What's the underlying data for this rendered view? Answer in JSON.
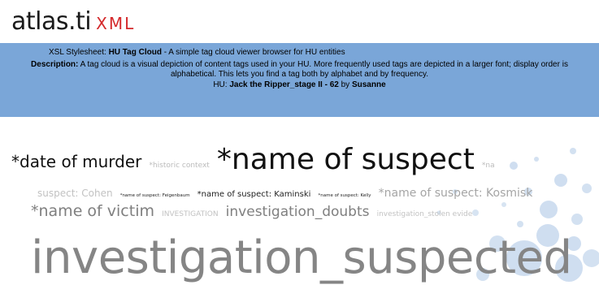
{
  "logo": {
    "main": "atlas.ti",
    "xml": "XML"
  },
  "header": {
    "xsl_prefix": "XSL Stylesheet: ",
    "xsl_name": "HU Tag Cloud",
    "xsl_suffix": " - A simple tag cloud viewer browser for HU entities",
    "desc_label": "Description:",
    "desc_text": " A tag cloud is a visual depiction of content tags used in your HU. More frequently used tags are depicted in a larger font; display order is alphabetical. This lets you find a tag both by alphabet and by frequency.",
    "hu_prefix": "HU: ",
    "hu_name": "Jack the Ripper_stage II - 62",
    "hu_by": " by ",
    "hu_author": "Susanne"
  },
  "colors": {
    "banner": "#7aa6d8",
    "logo_xml": "#d4292b",
    "bubble": "#a7c3e3"
  },
  "cloud": {
    "line1": [
      "*date of murder",
      "*historic context",
      "*name of suspect",
      "*na"
    ],
    "line2": [
      "suspect: Cohen",
      "*name of suspect: Feigenbaum",
      "*name of suspect: Kaminski",
      "*name of suspect: Kelly",
      "*name of suspect: Kosmisk"
    ],
    "line3": [
      "*name of victim",
      "INVESTIGATION",
      "investigation_doubts",
      "investigation_stolen evide"
    ],
    "line4": [
      "investigation_suspected"
    ]
  }
}
